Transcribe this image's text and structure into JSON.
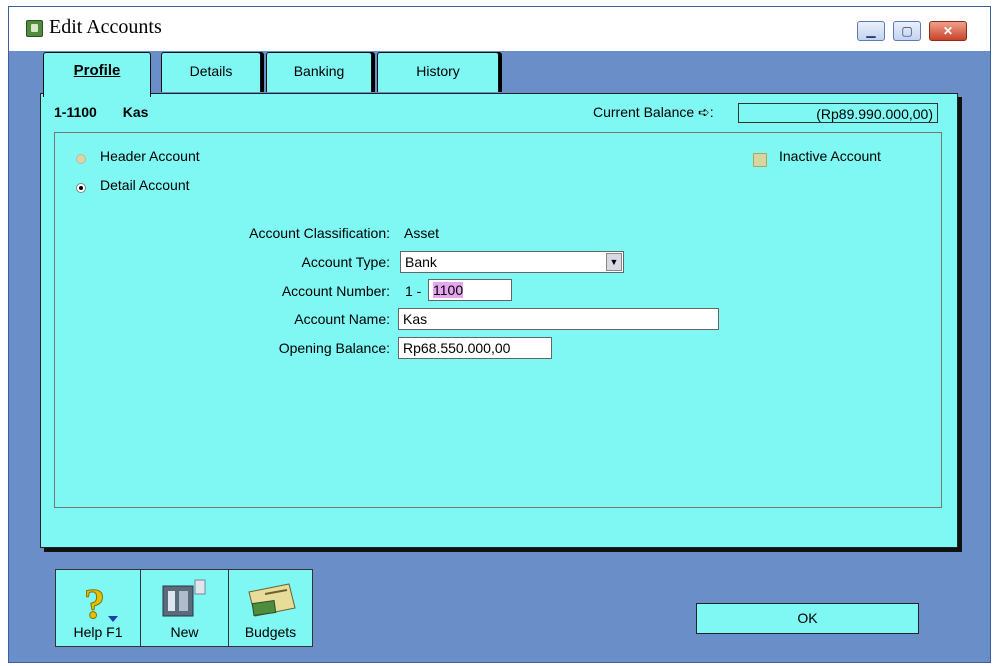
{
  "window": {
    "title": "Edit Accounts",
    "controls": [
      "minimize",
      "maximize",
      "close"
    ]
  },
  "tabs": [
    {
      "label": "Profile",
      "active": true
    },
    {
      "label": "Details",
      "active": false
    },
    {
      "label": "Banking",
      "active": false
    },
    {
      "label": "History",
      "active": false
    }
  ],
  "account": {
    "number": "1-1100",
    "name": "Kas",
    "current_balance_label": "Current Balance ➪:",
    "current_balance": "(Rp89.990.000,00)"
  },
  "options": {
    "header_account": "Header Account",
    "detail_account": "Detail Account",
    "inactive_account": "Inactive Account"
  },
  "form": {
    "classification_label": "Account Classification:",
    "classification_value": "Asset",
    "type_label": "Account Type:",
    "type_value": "Bank",
    "number_label": "Account Number:",
    "number_prefix": "1 -",
    "number_value": "1100",
    "name_label": "Account Name:",
    "name_value": "Kas",
    "opening_label": "Opening Balance:",
    "opening_value": "Rp68.550.000,00"
  },
  "toolbar": {
    "help": "Help F1",
    "new": "New",
    "budgets": "Budgets"
  },
  "ok": "OK"
}
